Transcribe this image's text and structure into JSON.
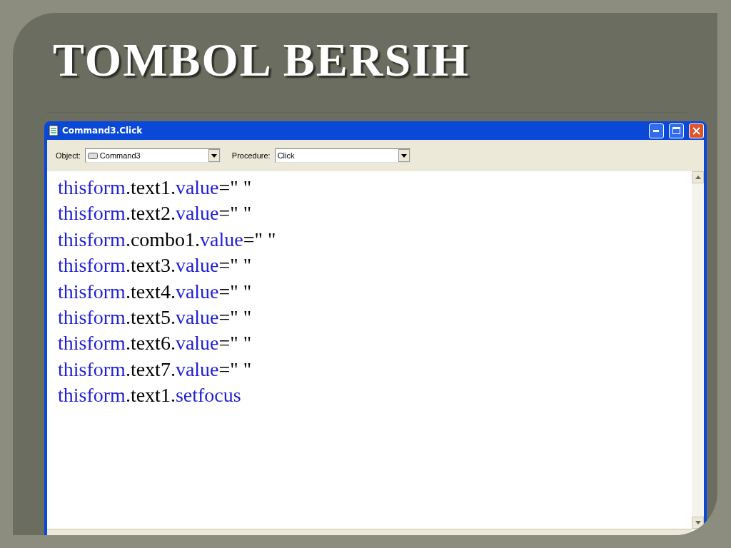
{
  "slide": {
    "title": "TOMBOL BERSIH"
  },
  "window": {
    "title": "Command3.Click",
    "object_label": "Object:",
    "object_value": "Command3",
    "procedure_label": "Procedure:",
    "procedure_value": "Click",
    "code_lines": [
      [
        {
          "text": "thisform",
          "kind": "keyword"
        },
        {
          "text": ".text1.",
          "kind": "plain"
        },
        {
          "text": "value",
          "kind": "keyword"
        },
        {
          "text": "=\" \"",
          "kind": "plain"
        }
      ],
      [
        {
          "text": "thisform",
          "kind": "keyword"
        },
        {
          "text": ".text2.",
          "kind": "plain"
        },
        {
          "text": "value",
          "kind": "keyword"
        },
        {
          "text": "=\" \"",
          "kind": "plain"
        }
      ],
      [
        {
          "text": "thisform",
          "kind": "keyword"
        },
        {
          "text": ".combo1.",
          "kind": "plain"
        },
        {
          "text": "value",
          "kind": "keyword"
        },
        {
          "text": "=\" \"",
          "kind": "plain"
        }
      ],
      [
        {
          "text": "thisform",
          "kind": "keyword"
        },
        {
          "text": ".text3.",
          "kind": "plain"
        },
        {
          "text": "value",
          "kind": "keyword"
        },
        {
          "text": "=\" \"",
          "kind": "plain"
        }
      ],
      [
        {
          "text": "thisform",
          "kind": "keyword"
        },
        {
          "text": ".text4.",
          "kind": "plain"
        },
        {
          "text": "value",
          "kind": "keyword"
        },
        {
          "text": "=\" \"",
          "kind": "plain"
        }
      ],
      [
        {
          "text": "thisform",
          "kind": "keyword"
        },
        {
          "text": ".text5.",
          "kind": "plain"
        },
        {
          "text": "value",
          "kind": "keyword"
        },
        {
          "text": "=\" \"",
          "kind": "plain"
        }
      ],
      [
        {
          "text": "thisform",
          "kind": "keyword"
        },
        {
          "text": ".text6.",
          "kind": "plain"
        },
        {
          "text": "value",
          "kind": "keyword"
        },
        {
          "text": "=\" \"",
          "kind": "plain"
        }
      ],
      [
        {
          "text": "thisform",
          "kind": "keyword"
        },
        {
          "text": ".text7.",
          "kind": "plain"
        },
        {
          "text": "value",
          "kind": "keyword"
        },
        {
          "text": "=\" \"",
          "kind": "plain"
        }
      ],
      [
        {
          "text": "thisform",
          "kind": "keyword"
        },
        {
          "text": ".text1.",
          "kind": "plain"
        },
        {
          "text": "setfocus",
          "kind": "keyword"
        }
      ]
    ]
  }
}
